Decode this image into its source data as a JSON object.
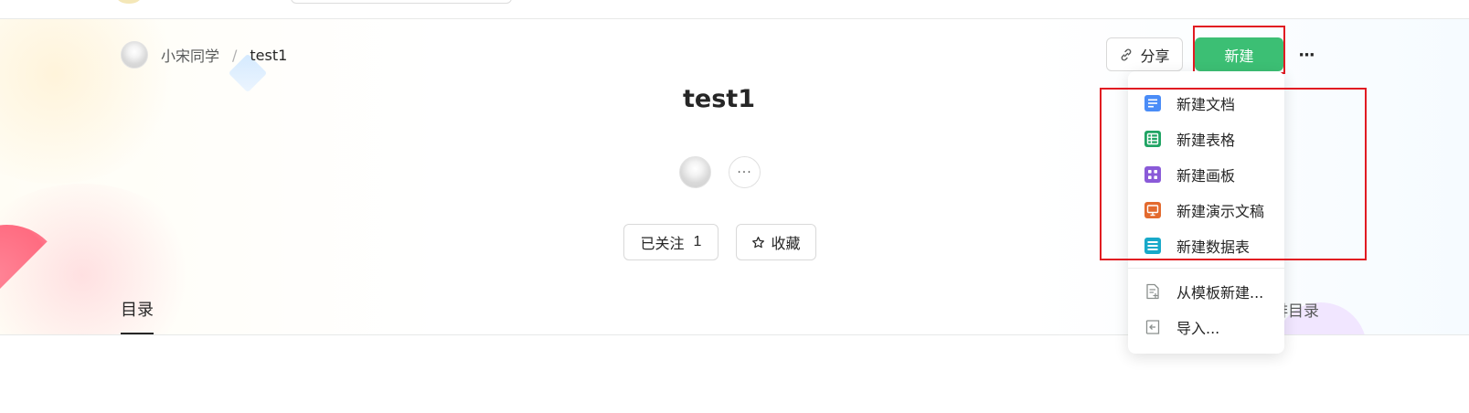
{
  "breadcrumb": {
    "user": "小宋同学",
    "separator": "/",
    "current": "test1"
  },
  "toolbar": {
    "share_label": "分享",
    "new_label": "新建",
    "more_label": "···"
  },
  "book": {
    "title": "test1",
    "member_more": "···"
  },
  "actions": {
    "follow_label": "已关注",
    "follow_count": "1",
    "favorite_label": "收藏"
  },
  "toc": {
    "tab_label": "目录",
    "edit_label": "排目录"
  },
  "new_menu": {
    "items": [
      {
        "label": "新建文档",
        "icon": "doc-icon",
        "color": "#4a8cf7"
      },
      {
        "label": "新建表格",
        "icon": "sheet-icon",
        "color": "#20a464"
      },
      {
        "label": "新建画板",
        "icon": "board-icon",
        "color": "#8a5ad8"
      },
      {
        "label": "新建演示文稿",
        "icon": "slides-icon",
        "color": "#e36a2e"
      },
      {
        "label": "新建数据表",
        "icon": "datatable-icon",
        "color": "#18a9c9"
      },
      {
        "label": "从模板新建...",
        "icon": "template-icon",
        "color": "#8a8f8d"
      },
      {
        "label": "导入...",
        "icon": "import-icon",
        "color": "#8a8f8d"
      }
    ]
  },
  "highlight_color": "#e11b22",
  "accent_green": "#3cbf74"
}
